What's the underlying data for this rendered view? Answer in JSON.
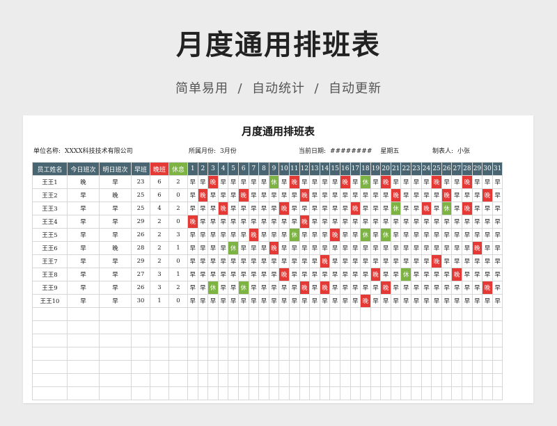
{
  "hero": {
    "title": "月度通用排班表",
    "subtitle": "简单易用  /  自动统计  /  自动更新"
  },
  "sheet": {
    "title": "月度通用排班表",
    "info": {
      "unit_label": "单位名称:",
      "unit_value": "XXXX科技技术有限公司",
      "month_label": "所属月份:",
      "month_value": "3月份",
      "date_label": "当前日期:",
      "date_value": "########",
      "weekday": "星期五",
      "maker_label": "制表人:",
      "maker_value": "小张"
    },
    "headers": {
      "name": "员工姓名",
      "today": "今日班次",
      "tomorrow": "明日班次",
      "early": "早班",
      "late": "晚班",
      "rest": "休息",
      "days": [
        "1",
        "2",
        "3",
        "4",
        "5",
        "6",
        "7",
        "8",
        "9",
        "10",
        "11",
        "12",
        "13",
        "14",
        "15",
        "16",
        "17",
        "18",
        "19",
        "20",
        "21",
        "22",
        "23",
        "24",
        "25",
        "26",
        "27",
        "28",
        "29",
        "30",
        "31"
      ]
    },
    "empty_rows": 7,
    "colors": {
      "header": "#4a6572",
      "late": "#e53935",
      "rest": "#7cb342"
    },
    "rows": [
      {
        "name": "王王1",
        "today": "晚",
        "tomorrow": "早",
        "early": "23",
        "late": "6",
        "rest": "2",
        "days": "早早晚早早早早早休早晚早早早早晚早休早晚早早早早晚早早晚早早早"
      },
      {
        "name": "王王2",
        "today": "早",
        "tomorrow": "晚",
        "early": "25",
        "late": "6",
        "rest": "0",
        "days": "早晚早早早晚早早早早早晚早早早早早早早早晚早早早早晚早早早晚早"
      },
      {
        "name": "王王3",
        "today": "早",
        "tomorrow": "早",
        "early": "25",
        "late": "4",
        "rest": "2",
        "days": "早早早晚早早早早早晚早早早早早早晚早早早休早早晚早休早晚早早早"
      },
      {
        "name": "王王4",
        "today": "早",
        "tomorrow": "早",
        "early": "29",
        "late": "2",
        "rest": "0",
        "days": "晚早早早早早早早早早早晚早早早早早早早早早早早早早早早早早早早"
      },
      {
        "name": "王王5",
        "today": "早",
        "tomorrow": "早",
        "early": "26",
        "late": "2",
        "rest": "3",
        "days": "早早早早早早晚早早早休早早早晚早早休早休早早早早早早早早早早早"
      },
      {
        "name": "王王6",
        "today": "早",
        "tomorrow": "晚",
        "early": "28",
        "late": "2",
        "rest": "1",
        "days": "早早早早休早早早晚早早早早早早早早早早早早早早早早早早早晚早早"
      },
      {
        "name": "王王7",
        "today": "早",
        "tomorrow": "早",
        "early": "29",
        "late": "2",
        "rest": "0",
        "days": "早早早早早早早早早早早早早晚早早早早早早早早早早晚早早早早早早"
      },
      {
        "name": "王王8",
        "today": "早",
        "tomorrow": "早",
        "early": "27",
        "late": "3",
        "rest": "1",
        "days": "早早早早早早早早早晚早早早早早早早早晚早早休早早早早晚早早早早"
      },
      {
        "name": "王王9",
        "today": "早",
        "tomorrow": "早",
        "early": "26",
        "late": "3",
        "rest": "2",
        "days": "早早休早早休早早早早早晚早晚早早早早早晚早早早早早早早早早晚早"
      },
      {
        "name": "王王10",
        "today": "早",
        "tomorrow": "早",
        "early": "30",
        "late": "1",
        "rest": "0",
        "days": "早早早早早早早早早早早早早早早早早晚早早早早早早早早早早早早早"
      }
    ]
  }
}
